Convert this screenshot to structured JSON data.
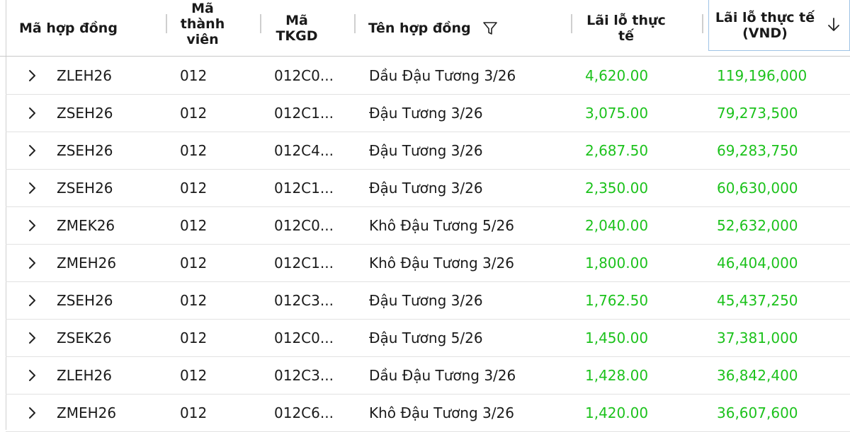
{
  "columns": {
    "contract_code": "Mã hợp đồng",
    "member_code_lines": [
      "Mã",
      "thành",
      "viên"
    ],
    "account_code_lines": [
      "Mã",
      "TKGD"
    ],
    "contract_name": "Tên hợp đồng",
    "pnl_lines": [
      "Lãi lỗ thực",
      "tế"
    ],
    "pnl_vnd_lines": [
      "Lãi lỗ thực tế",
      "(VND)"
    ]
  },
  "icons": {
    "filter": "filter-icon",
    "sort_desc": "arrow-down-icon",
    "expand": "chevron-right-icon"
  },
  "colors": {
    "positive": "#1cc21c",
    "sort_highlight": "#9ec3e6"
  },
  "rows": [
    {
      "contract_code": "ZLEH26",
      "member_code": "012",
      "account_code": "012C0...",
      "contract_name": "Dầu Đậu Tương 3/26",
      "pnl": "4,620.00",
      "pnl_vnd": "119,196,000"
    },
    {
      "contract_code": "ZSEH26",
      "member_code": "012",
      "account_code": "012C1...",
      "contract_name": "Đậu Tương 3/26",
      "pnl": "3,075.00",
      "pnl_vnd": "79,273,500"
    },
    {
      "contract_code": "ZSEH26",
      "member_code": "012",
      "account_code": "012C4...",
      "contract_name": "Đậu Tương 3/26",
      "pnl": "2,687.50",
      "pnl_vnd": "69,283,750"
    },
    {
      "contract_code": "ZSEH26",
      "member_code": "012",
      "account_code": "012C1...",
      "contract_name": "Đậu Tương 3/26",
      "pnl": "2,350.00",
      "pnl_vnd": "60,630,000"
    },
    {
      "contract_code": "ZMEK26",
      "member_code": "012",
      "account_code": "012C0...",
      "contract_name": "Khô Đậu Tương 5/26",
      "pnl": "2,040.00",
      "pnl_vnd": "52,632,000"
    },
    {
      "contract_code": "ZMEH26",
      "member_code": "012",
      "account_code": "012C1...",
      "contract_name": "Khô Đậu Tương 3/26",
      "pnl": "1,800.00",
      "pnl_vnd": "46,404,000"
    },
    {
      "contract_code": "ZSEH26",
      "member_code": "012",
      "account_code": "012C3...",
      "contract_name": "Đậu Tương 3/26",
      "pnl": "1,762.50",
      "pnl_vnd": "45,437,250"
    },
    {
      "contract_code": "ZSEK26",
      "member_code": "012",
      "account_code": "012C0...",
      "contract_name": "Đậu Tương 5/26",
      "pnl": "1,450.00",
      "pnl_vnd": "37,381,000"
    },
    {
      "contract_code": "ZLEH26",
      "member_code": "012",
      "account_code": "012C3...",
      "contract_name": "Dầu Đậu Tương 3/26",
      "pnl": "1,428.00",
      "pnl_vnd": "36,842,400"
    },
    {
      "contract_code": "ZMEH26",
      "member_code": "012",
      "account_code": "012C6...",
      "contract_name": "Khô Đậu Tương 3/26",
      "pnl": "1,420.00",
      "pnl_vnd": "36,607,600"
    }
  ]
}
